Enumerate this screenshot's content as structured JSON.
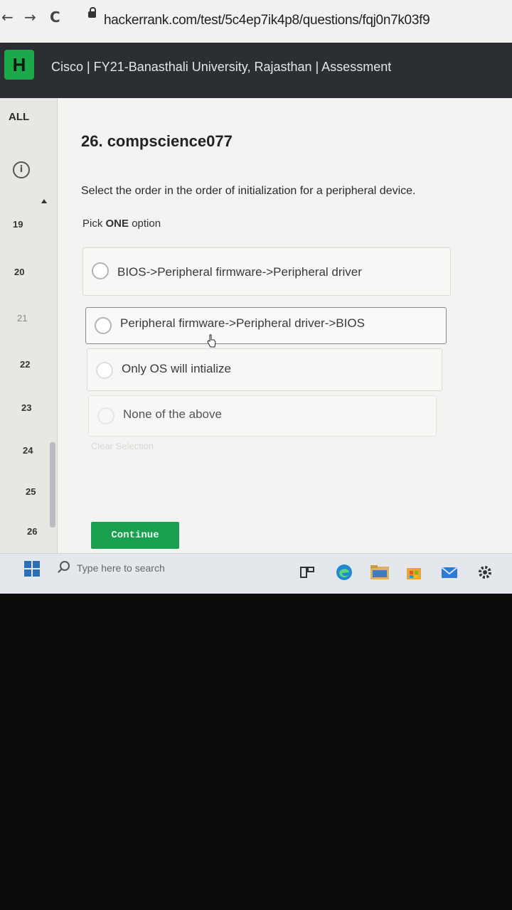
{
  "browser": {
    "url": "hackerrank.com/test/5c4ep7ik4p8/questions/fqj0n7k03f9",
    "back": "←",
    "forward": "→",
    "reload": "C"
  },
  "header": {
    "logo": "H",
    "title": "Cisco | FY21-Banasthali University, Rajasthan | Assessment"
  },
  "sidebar": {
    "all_label": "ALL",
    "info_glyph": "i",
    "questions": [
      "19",
      "20",
      "21",
      "22",
      "23",
      "24",
      "25",
      "26"
    ]
  },
  "question": {
    "title": "26. compscience077",
    "text": "Select the order in the order of initialization for a peripheral device.",
    "pick_prefix": "Pick ",
    "pick_bold": "ONE",
    "pick_suffix": " option",
    "options": [
      "BIOS->Peripheral firmware->Peripheral driver",
      "Peripheral firmware->Peripheral driver->BIOS",
      "Only OS will intialize",
      "None of the above"
    ],
    "clear_selection": "Clear Selection"
  },
  "actions": {
    "continue_label": "Continue"
  },
  "taskbar": {
    "search_placeholder": "Type here to search",
    "icons": [
      "windows-start-icon",
      "search-icon",
      "task-view-icon",
      "edge-icon",
      "file-explorer-icon",
      "store-icon",
      "mail-icon",
      "settings-icon"
    ]
  },
  "colors": {
    "accent_green": "#1a9f4f",
    "header_dark": "#2b2e33"
  }
}
